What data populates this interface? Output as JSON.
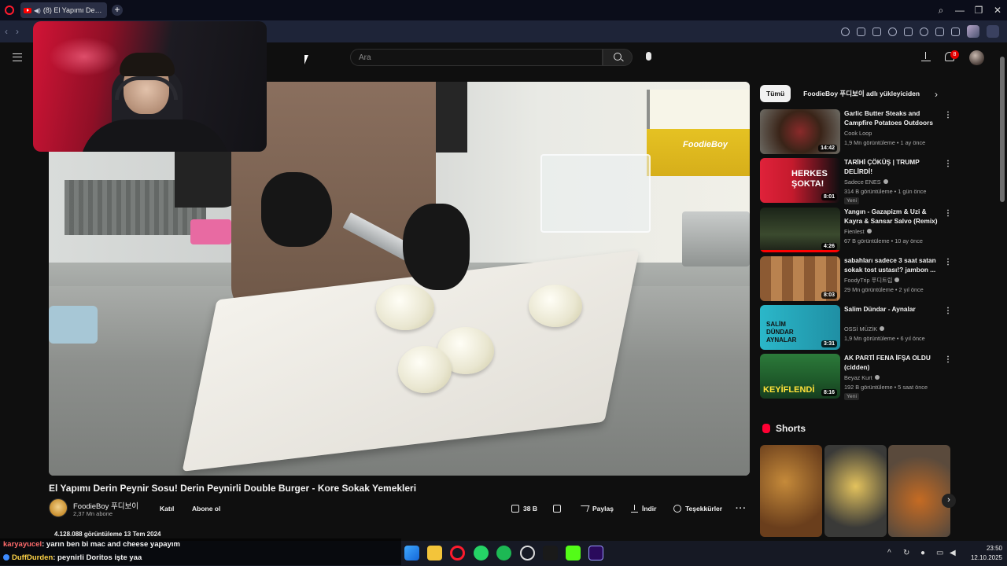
{
  "browser": {
    "tab_title": "(8) El Yapımı Derin Pe",
    "new_tab_label": "+",
    "tab_sound_icon": "speaker-icon"
  },
  "youtube": {
    "search_placeholder": "Ara",
    "notification_count": "8"
  },
  "video": {
    "title": "El Yapımı Derin Peynir Sosu! Derin Peynirli Double Burger - Kore Sokak Yemekleri",
    "watermark": "FoodieBoy",
    "channel_name": "FoodieBoy 푸디보이",
    "subscribers": "2,37 Mn abone",
    "join_label": "Katıl",
    "subscribe_label": "Abone ol",
    "likes": "38 B",
    "share_label": "Paylaş",
    "download_label": "İndir",
    "thanks_label": "Teşekkürler",
    "more_label": "···",
    "views_date": "4.128.088 görüntüleme  13 Tem 2024"
  },
  "chat": [
    {
      "user": "karyayucel",
      "message": ": yarın ben bi mac and cheese yapayım"
    },
    {
      "user": "DuffDurden",
      "message": ": peynirli Doritos işte yaa"
    }
  ],
  "sidebar": {
    "chips": [
      "Tümü",
      "FoodieBoy 푸디보이 adlı yükleyiciden"
    ],
    "recommendations": [
      {
        "title": "Garlic Butter Steaks and Campfire Potatoes Outdoors",
        "channel": "Cook Loop",
        "meta": "1,9 Mn görüntüleme • 1 ay önce",
        "duration": "14:42",
        "badge": ""
      },
      {
        "title": "TARİHİ ÇÖKÜŞ | TRUMP DELİRDİ!",
        "channel": "Sadece ENES",
        "meta": "314 B görüntüleme • 1 gün önce",
        "duration": "8:01",
        "badge": "Yeni"
      },
      {
        "title": "Yangın - Gazapizm & Uzi & Kayra & Sansar Salvo (Remix)",
        "channel": "Fienlest",
        "meta": "67 B görüntüleme • 10 ay önce",
        "duration": "4:26",
        "badge": ""
      },
      {
        "title": "sabahları sadece 3 saat satan sokak tost ustası!? jambon ...",
        "channel": "FoodyTrip 푸디트립",
        "meta": "29 Mn görüntüleme • 2 yıl önce",
        "duration": "8:03",
        "badge": ""
      },
      {
        "title": "Salim Dündar - Aynalar",
        "channel": "OSSİ MÜZİK",
        "meta": "1,9 Mn görüntüleme • 6 yıl önce",
        "duration": "3:31",
        "badge": ""
      },
      {
        "title": "AK PARTİ FENA İFŞA OLDU (cidden)",
        "channel": "Beyaz Kurt",
        "meta": "192 B görüntüleme • 5 saat önce",
        "duration": "8:16",
        "badge": "Yeni"
      }
    ],
    "thumb_overlays": [
      "HERKES ŞOKTA!",
      "SALİM DÜNDAR AYNALAR",
      "KEYİFLENDİ"
    ],
    "shorts_title": "Shorts"
  },
  "system": {
    "time": "23:50",
    "date": "12.10.2025"
  }
}
